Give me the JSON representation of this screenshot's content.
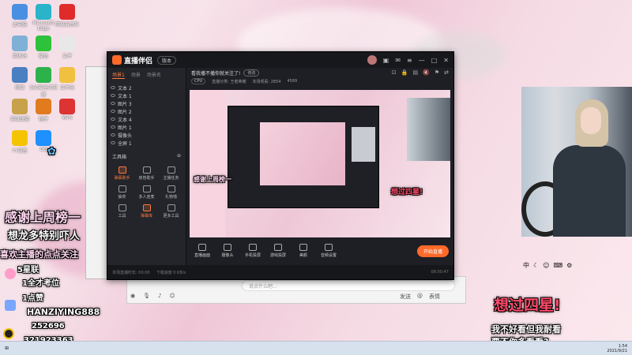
{
  "desktop": {
    "icons": [
      {
        "label": "此电脑",
        "color": "#4a90e2"
      },
      {
        "label": "Microsoft Edge",
        "color": "#2ab3c9"
      },
      {
        "label": "网易云音乐",
        "color": "#e02b2b"
      },
      {
        "label": "回收站",
        "color": "#7fb0d6"
      },
      {
        "label": "微信",
        "color": "#2ec13b"
      },
      {
        "label": "文件",
        "color": "#e8e8e8"
      },
      {
        "label": "网络",
        "color": "#4a7fc1"
      },
      {
        "label": "360安全浏览器",
        "color": "#2db24b"
      },
      {
        "label": "文件夹",
        "color": "#f0c040"
      },
      {
        "label": "英雄联盟",
        "color": "#c8a24a"
      },
      {
        "label": "程序",
        "color": "#e07b1e"
      },
      {
        "label": "WPS",
        "color": "#d33"
      },
      {
        "label": "YY语音",
        "color": "#f5c400"
      },
      {
        "label": "QQ",
        "color": "#1e90ff"
      }
    ]
  },
  "overlay": {
    "thanks_line1": "感谢上周榜一",
    "thanks_line2": "想龙多特别吓人",
    "follow_line": "喜欢主播的点点关注",
    "rule1": "5星联",
    "rule2": "1全才考位",
    "rule3": "1点赞",
    "id_line": "HANZIYING888",
    "num_line": "252696",
    "qq_line": "321923363",
    "right_big": "想过四星!",
    "right_line1": "我不好看但我耐看",
    "right_line2": "要不你多看看?"
  },
  "app": {
    "name": "直播伴侣",
    "tag": "版本",
    "side_tabs": [
      "场景1",
      "场景",
      "场景名"
    ],
    "sources": [
      "文本 2",
      "文本 1",
      "图片 3",
      "图片 2",
      "文本 4",
      "图片 1",
      "摄像头",
      "全屏 1"
    ],
    "tools_header": "工具箱",
    "tools": [
      {
        "label": "弹幕助手",
        "hot": true
      },
      {
        "label": "房管助手",
        "hot": false
      },
      {
        "label": "主播任务",
        "hot": false
      },
      {
        "label": "抽奖",
        "hot": false
      },
      {
        "label": "多人连麦",
        "hot": false
      },
      {
        "label": "礼物墙",
        "hot": false
      },
      {
        "label": "工具",
        "hot": false
      },
      {
        "label": "弹幕库",
        "hot": true
      },
      {
        "label": "更多工具",
        "hot": false
      }
    ],
    "announce": "看我播不播你就关注了!",
    "announce_btn": "修改",
    "stats": [
      "CPU",
      "直播分类: 王者荣耀",
      "本场观看: 2854",
      "4589"
    ],
    "bottom_buttons": [
      "直播画面",
      "摄像头",
      "手机投屏",
      "游戏投屏",
      "美颜",
      "音频设置"
    ],
    "start_live": "开始直播",
    "status_left": "本场直播时长: 00:00",
    "status_mid": "下载速度 0 KB/s",
    "status_right": "08:00:47"
  },
  "chat": {
    "placeholder": "说点什么吧...",
    "icons": [
      "发送",
      "@",
      "表情"
    ]
  },
  "taskbar": {
    "time": "1:54",
    "date": "2021/9/21",
    "tray": "中"
  }
}
